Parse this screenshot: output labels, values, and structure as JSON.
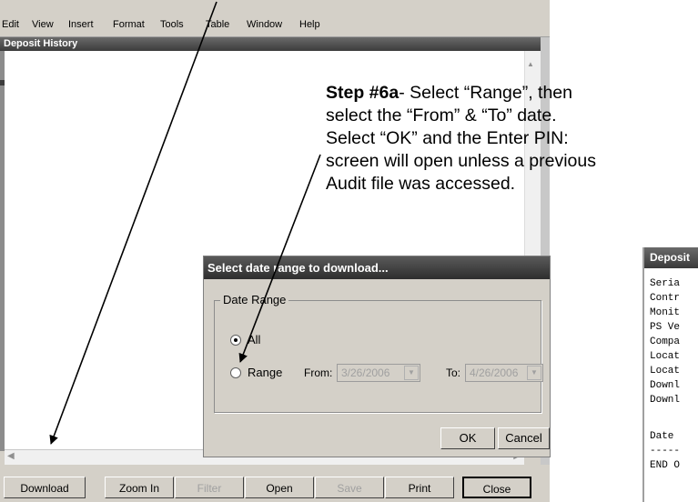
{
  "menu": [
    "Edit",
    "View",
    "Insert",
    "Format",
    "Tools",
    "Table",
    "Window",
    "Help"
  ],
  "window_title": "Deposit History",
  "buttons": [
    "Download",
    "Zoom In",
    "Filter",
    "Open",
    "Save",
    "Print",
    "Close"
  ],
  "annotation": {
    "step": "Step #6a",
    "text_1": "- Select “Range”, then",
    "text_2": "select the “From” & “To” date.",
    "text_3": "Select  “OK”  and the Enter PIN:",
    "text_4": "screen will open unless a previous",
    "text_5": "Audit file was accessed."
  },
  "dialog": {
    "title": "Select date range to download...",
    "group_label": "Date Range",
    "option_all": "All",
    "option_range": "Range",
    "from_label": "From:",
    "from_value": "3/26/2006",
    "to_label": "To:",
    "to_value": "4/26/2006",
    "ok": "OK",
    "cancel": "Cancel",
    "selected_option": "All"
  },
  "report": {
    "title": "Deposit",
    "lines": [
      "Seria",
      "Contr",
      "Monit",
      "PS Ve",
      "Compa",
      "Locat",
      "Locat",
      "Downl",
      "Downl",
      "",
      "Date",
      "-----",
      "END O"
    ]
  }
}
